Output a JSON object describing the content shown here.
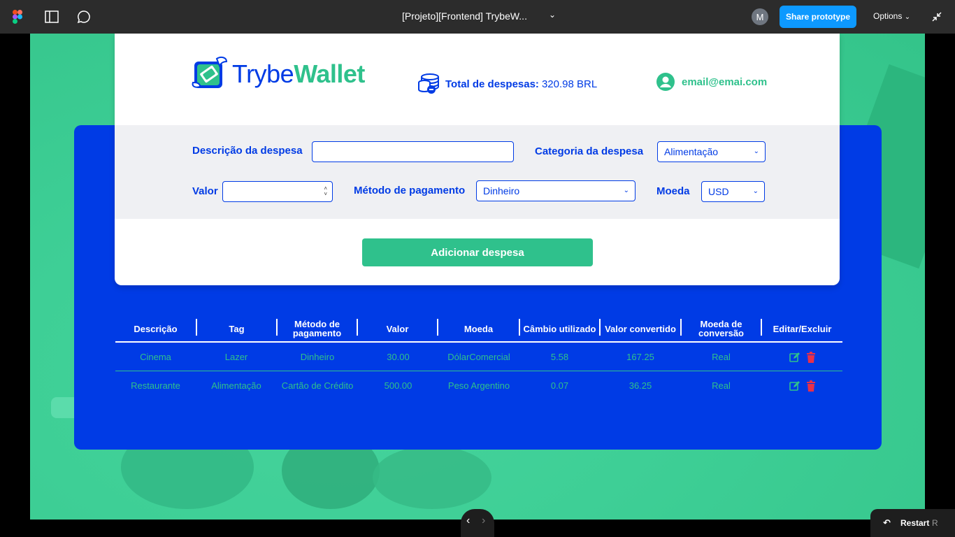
{
  "figma": {
    "document_title": "[Projeto][Frontend] TrybeW...",
    "avatar_initial": "M",
    "share_label": "Share prototype",
    "options_label": "Options",
    "restart_label": "Restart",
    "restart_shortcut": "R"
  },
  "app": {
    "logo": {
      "part1": "Trybe",
      "part2": "Wallet"
    },
    "header": {
      "total_label": "Total de despesas:",
      "total_value": "320.98 BRL",
      "email": "email@emai.com"
    },
    "form": {
      "description_label": "Descrição da despesa",
      "description_value": "",
      "category_label": "Categoria da despesa",
      "category_value": "Alimentação",
      "value_label": "Valor",
      "value_value": "",
      "method_label": "Método de pagamento",
      "method_value": "Dinheiro",
      "currency_label": "Moeda",
      "currency_value": "USD",
      "add_button": "Adicionar despesa"
    },
    "table": {
      "headers": [
        "Descrição",
        "Tag",
        "Método de pagamento",
        "Valor",
        "Moeda",
        "Câmbio utilizado",
        "Valor convertido",
        "Moeda de conversão",
        "Editar/Excluir"
      ],
      "rows": [
        [
          "Cinema",
          "Lazer",
          "Dinheiro",
          "30.00",
          "DólarComercial",
          "5.58",
          "167.25",
          "Real"
        ],
        [
          "Restaurante",
          "Alimentação",
          "Cartão de Crédito",
          "500.00",
          "Peso Argentino",
          "0.07",
          "36.25",
          "Real"
        ]
      ]
    }
  },
  "colors": {
    "brand_blue": "#003be5",
    "brand_green": "#2fc18c",
    "delete_red": "#e8304a",
    "figma_blue": "#0d99ff"
  }
}
